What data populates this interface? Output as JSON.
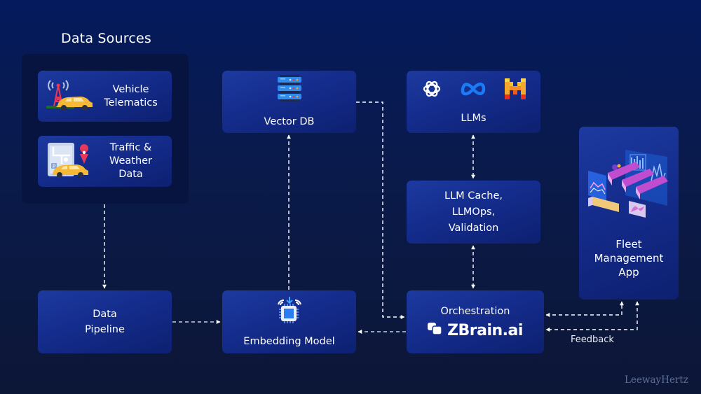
{
  "diagram": {
    "title": "Data Sources",
    "sources": [
      {
        "label_lines": [
          "Vehicle",
          "Telematics"
        ],
        "icon": "telematics-tower-car-icon"
      },
      {
        "label_lines": [
          "Traffic &",
          "Weather",
          "Data"
        ],
        "icon": "map-car-pin-icon"
      }
    ],
    "nodes": {
      "vector_db": {
        "label": "Vector DB",
        "icon": "server-stack-icon"
      },
      "llms": {
        "label": "LLMs",
        "icons": [
          "openai-icon",
          "meta-icon",
          "mistral-icon"
        ]
      },
      "llm_cache": {
        "label_lines": [
          "LLM Cache,",
          "LLMOps,",
          "Validation"
        ]
      },
      "fleet_app": {
        "label_lines": [
          "Fleet",
          "Management",
          "App"
        ],
        "icon": "fleet-trucks-illustration-icon"
      },
      "data_pipeline": {
        "label_lines": [
          "Data",
          "Pipeline"
        ]
      },
      "embedding_model": {
        "label": "Embedding Model",
        "icon": "chip-icon"
      },
      "orchestration": {
        "label": "Orchestration",
        "brand": "ZBrain.ai",
        "icon": "zbrain-logo-icon"
      }
    },
    "edge_labels": {
      "feedback": "Feedback"
    },
    "edges": [
      {
        "from": "Data Sources",
        "to": "Data Pipeline"
      },
      {
        "from": "Data Pipeline",
        "to": "Embedding Model"
      },
      {
        "from": "Embedding Model",
        "to": "Vector DB"
      },
      {
        "from": "Vector DB",
        "to": "Orchestration"
      },
      {
        "from": "Orchestration",
        "to": "Embedding Model"
      },
      {
        "from": "LLMs",
        "to": "LLM Cache, LLMOps, Validation",
        "bidirectional": true
      },
      {
        "from": "LLM Cache, LLMOps, Validation",
        "to": "Orchestration",
        "bidirectional": true
      },
      {
        "from": "Orchestration",
        "to": "Fleet Management App",
        "bidirectional": true
      },
      {
        "from": "Fleet Management App",
        "to": "Orchestration",
        "label": "Feedback"
      }
    ],
    "watermark": "LeewayHertz",
    "colors": {
      "background": "#041a5c",
      "box": "#1a3596",
      "group": "#07143f",
      "arrow": "#ffffff"
    }
  }
}
